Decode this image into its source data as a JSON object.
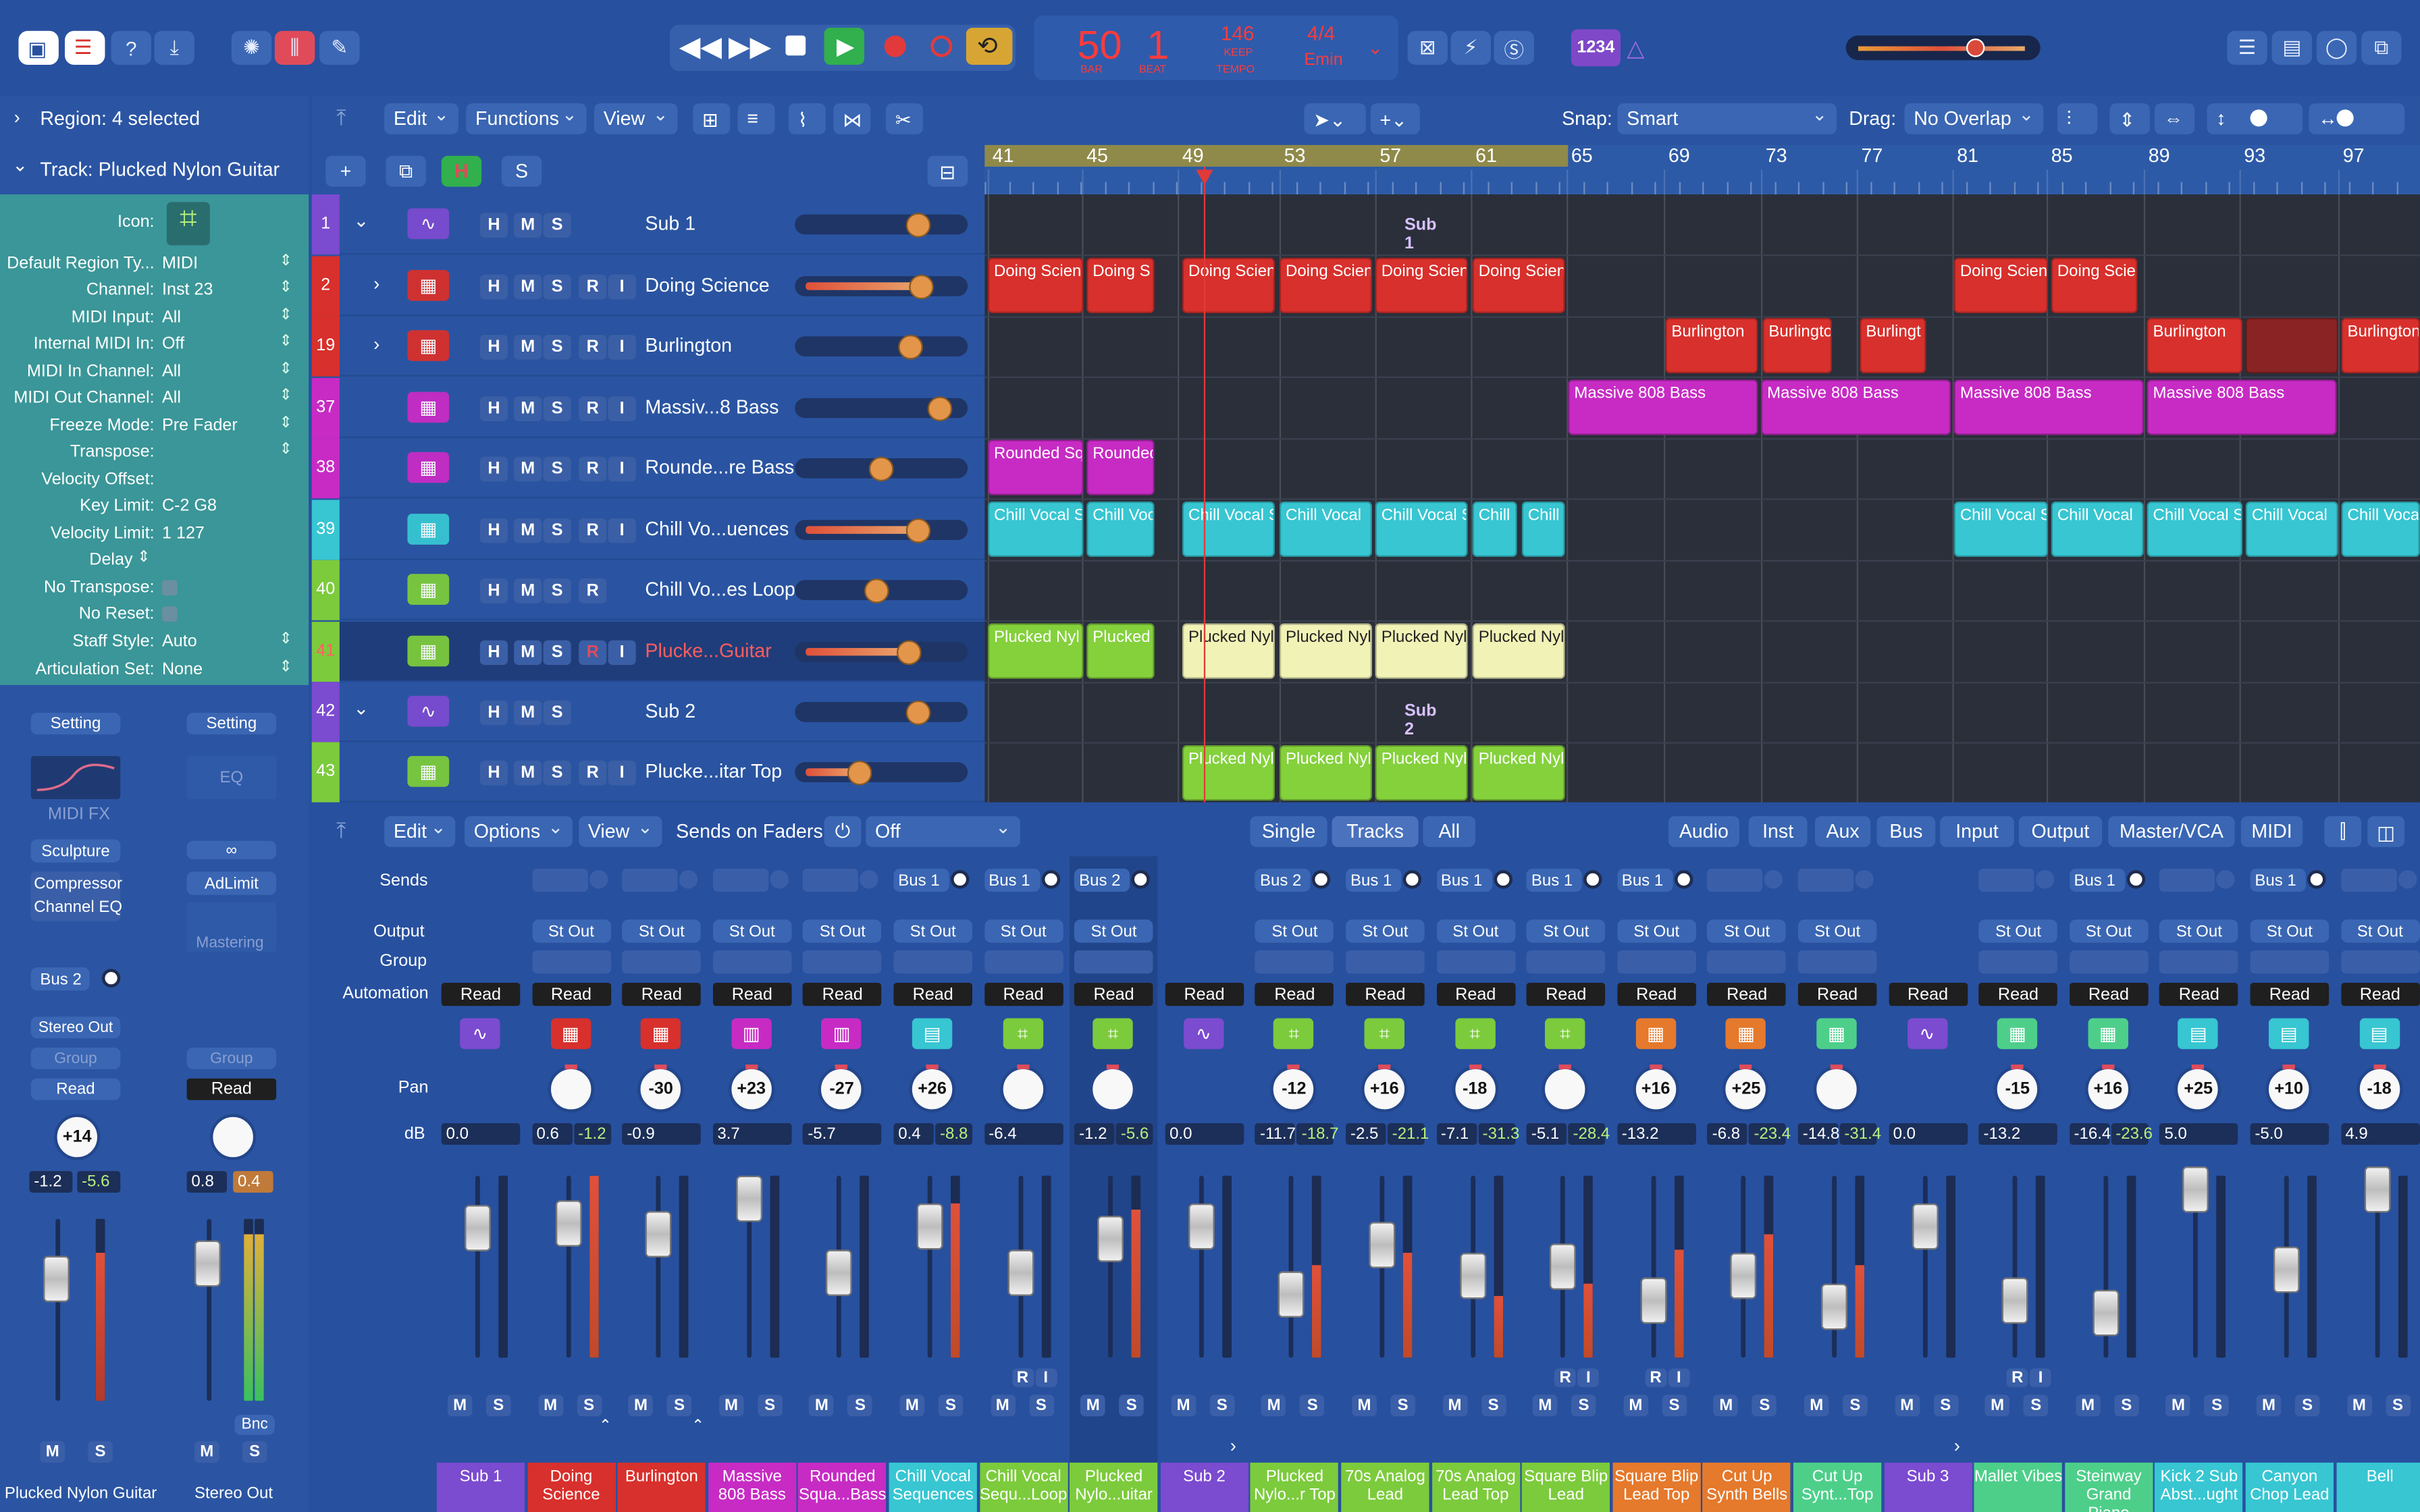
{
  "lcd": {
    "bar": "50",
    "bar_lbl": "BAR",
    "beat": "1",
    "beat_lbl": "BEAT",
    "tempo": "146",
    "keep": "KEEP",
    "tempo_lbl": "TEMPO",
    "sig": "4/4",
    "key": "Emin"
  },
  "count_in": "1234",
  "inspector": {
    "region": "Region: 4 selected",
    "track": "Track: Plucked Nylon Guitar",
    "rows": [
      [
        "Icon:",
        ""
      ],
      [
        "Default Region Ty...",
        "MIDI"
      ],
      [
        "Channel:",
        "Inst 23"
      ],
      [
        "MIDI Input:",
        "All"
      ],
      [
        "Internal MIDI In:",
        "Off"
      ],
      [
        "MIDI In Channel:",
        "All"
      ],
      [
        "MIDI Out Channel:",
        "All"
      ],
      [
        "Freeze Mode:",
        "Pre Fader"
      ],
      [
        "Transpose:",
        ""
      ],
      [
        "Velocity Offset:",
        ""
      ],
      [
        "Key Limit:",
        "C-2  G8"
      ],
      [
        "Velocity Limit:",
        "1  127"
      ],
      [
        "Delay",
        ""
      ],
      [
        "No Transpose:",
        ""
      ],
      [
        "No Reset:",
        ""
      ],
      [
        "Staff Style:",
        "Auto"
      ],
      [
        "Articulation Set:",
        "None"
      ]
    ],
    "strip1": {
      "setting": "Setting",
      "midifx": "MIDI FX",
      "plug1": "Sculpture",
      "plug2": "Compressor",
      "plug3": "Channel EQ",
      "send": "Bus 2",
      "out": "Stereo Out",
      "group": "Group",
      "read": "Read",
      "pan": "+14",
      "db1": "-1.2",
      "db2": "-5.6",
      "m": "M",
      "s": "S",
      "name": "Plucked Nylon Guitar"
    },
    "strip2": {
      "setting": "Setting",
      "eq": "EQ",
      "plug1": "AdLimit",
      "mastering": "Mastering",
      "group": "Group",
      "read": "Read",
      "db1": "0.8",
      "db2": "0.4",
      "bnc": "Bnc",
      "m": "M",
      "s": "S",
      "name": "Stereo Out"
    }
  },
  "tracks_toolbar": {
    "edit": "Edit",
    "functions": "Functions",
    "view": "View",
    "snap_lbl": "Snap:",
    "snap": "Smart",
    "drag_lbl": "Drag:",
    "drag": "No Overlap"
  },
  "ruler": [
    "41",
    "45",
    "49",
    "53",
    "57",
    "61",
    "65",
    "69",
    "73",
    "77",
    "81",
    "85",
    "89",
    "93",
    "97"
  ],
  "tracks": [
    {
      "num": "2",
      "name": "Doing Science",
      "color": "#d8302c",
      "btns": "HMSRI"
    },
    {
      "num": "19",
      "name": "Burlington",
      "color": "#d8302c",
      "btns": "HMSRI"
    },
    {
      "num": "37",
      "name": "Massiv...8 Bass",
      "color": "#c72bc4",
      "btns": "HMSRI"
    },
    {
      "num": "38",
      "name": "Rounde...re Bass",
      "color": "#c72bc4",
      "btns": "HMSRI"
    },
    {
      "num": "39",
      "name": "Chill Vo...uences",
      "color": "#37c6d2",
      "btns": "HMSRI"
    },
    {
      "num": "40",
      "name": "Chill Vo...es Loop",
      "color": "#7ccb3c",
      "btns": "HMSR"
    },
    {
      "num": "41",
      "name": "Plucke...Guitar",
      "color": "#7ccb3c",
      "btns": "HMSRI"
    },
    {
      "num": "43",
      "name": "Plucke...itar Top",
      "color": "#7ccb3c",
      "btns": "HMSRI"
    }
  ],
  "subs": [
    {
      "num": "1",
      "name": "Sub 1"
    },
    {
      "num": "42",
      "name": "Sub 2"
    }
  ],
  "regions": {
    "sub1": "Sub 1",
    "sub2": "Sub 2",
    "doing": [
      "Doing Scien",
      "Doing S",
      "Doing Scien",
      "Doing Scien",
      "Doing Scien",
      "Doing Scien",
      "Doing Scien",
      "Doing Scie"
    ],
    "burl": [
      "Burlington",
      "Burlingto",
      "Burlingt",
      "Burlington",
      "Burlington"
    ],
    "massive": [
      "Massive 808 Bass",
      "Massive 808 Bass",
      "Massive 808 Bass",
      "Massive 808 Bass"
    ],
    "rounded": [
      "Rounded Sq",
      "Rounded"
    ],
    "chill": [
      "Chill Vocal S",
      "Chill Voc",
      "Chill Vocal S",
      "Chill Vocal",
      "Chill Vocal S",
      "Chill",
      "Chill",
      "Chill Vocal S",
      "Chill Vocal",
      "Chill Vocal S",
      "Chill Vocal",
      "Chill Voca"
    ],
    "pluck": [
      "Plucked Nyl",
      "Plucked",
      "Plucked Nyl",
      "Plucked Nyl",
      "Plucked Nyl",
      "Plucked Nyl"
    ],
    "pluck2": [
      "Plucked Nyl",
      "Plucked Nyl",
      "Plucked Nyl",
      "Plucked Nyl"
    ]
  },
  "mixer_toolbar": {
    "edit": "Edit",
    "options": "Options",
    "view": "View",
    "sends_lbl": "Sends on Faders:",
    "sends": "Off",
    "single": "Single",
    "tracks": "Tracks",
    "all": "All",
    "filters": [
      "Audio",
      "Inst",
      "Aux",
      "Bus",
      "Input",
      "Output",
      "Master/VCA",
      "MIDI"
    ]
  },
  "mixer_labels": {
    "sends": "Sends",
    "output": "Output",
    "group": "Group",
    "automation": "Automation",
    "pan": "Pan",
    "db": "dB"
  },
  "channels": [
    {
      "name": "Sub 1",
      "color": "#7b4bd0",
      "send": "",
      "out": "",
      "pan": "",
      "db1": "0.0",
      "db2": ""
    },
    {
      "name": "Doing Science",
      "color": "#d8302c",
      "send": "",
      "out": "St Out",
      "pan": "",
      "db1": "0.6",
      "db2": "-1.2"
    },
    {
      "name": "Burlington",
      "color": "#d8302c",
      "send": "",
      "out": "St Out",
      "pan": "-30",
      "db1": "-0.9",
      "db2": ""
    },
    {
      "name": "Massive 808 Bass",
      "color": "#c72bc4",
      "send": "",
      "out": "St Out",
      "pan": "+23",
      "db1": "3.7",
      "db2": ""
    },
    {
      "name": "Rounded Squa...Bass",
      "color": "#c72bc4",
      "send": "",
      "out": "St Out",
      "pan": "-27",
      "db1": "-5.7",
      "db2": ""
    },
    {
      "name": "Chill Vocal Sequences",
      "color": "#37c6d2",
      "send": "Bus 1",
      "out": "St Out",
      "pan": "+26",
      "db1": "0.4",
      "db2": "-8.8"
    },
    {
      "name": "Chill Vocal Sequ...Loop",
      "color": "#7ccb3c",
      "send": "Bus 1",
      "out": "St Out",
      "pan": "",
      "db1": "-6.4",
      "db2": ""
    },
    {
      "name": "Plucked Nylo...uitar",
      "color": "#7ccb3c",
      "send": "Bus 2",
      "out": "St Out",
      "pan": "",
      "db1": "-1.2",
      "db2": "-5.6"
    },
    {
      "name": "Sub 2",
      "color": "#7b4bd0",
      "send": "",
      "out": "",
      "pan": "",
      "db1": "0.0",
      "db2": ""
    },
    {
      "name": "Plucked Nylo...r Top",
      "color": "#7ccb3c",
      "send": "Bus 2",
      "out": "St Out",
      "pan": "-12",
      "db1": "-11.7",
      "db2": "-18.7"
    },
    {
      "name": "70s Analog Lead",
      "color": "#7ccb3c",
      "send": "Bus 1",
      "out": "St Out",
      "pan": "+16",
      "db1": "-2.5",
      "db2": "-21.1"
    },
    {
      "name": "70s Analog Lead Top",
      "color": "#7ccb3c",
      "send": "Bus 1",
      "out": "St Out",
      "pan": "-18",
      "db1": "-7.1",
      "db2": "-31.3"
    },
    {
      "name": "Square Blip Lead",
      "color": "#7ccb3c",
      "send": "Bus 1",
      "out": "St Out",
      "pan": "",
      "db1": "-5.1",
      "db2": "-28.4"
    },
    {
      "name": "Square Blip Lead Top",
      "color": "#e5792c",
      "send": "Bus 1",
      "out": "St Out",
      "pan": "+16",
      "db1": "-13.2",
      "db2": ""
    },
    {
      "name": "Cut Up Synth Bells",
      "color": "#e5792c",
      "send": "",
      "out": "St Out",
      "pan": "+25",
      "db1": "-6.8",
      "db2": "-23.4"
    },
    {
      "name": "Cut Up Synt...Top",
      "color": "#4dcf8a",
      "send": "",
      "out": "St Out",
      "pan": "",
      "db1": "-14.8",
      "db2": "-31.4"
    },
    {
      "name": "Sub 3",
      "color": "#7b4bd0",
      "send": "",
      "out": "",
      "pan": "",
      "db1": "0.0",
      "db2": ""
    },
    {
      "name": "Mallet Vibes",
      "color": "#4dcf8a",
      "send": "",
      "out": "St Out",
      "pan": "-15",
      "db1": "-13.2",
      "db2": ""
    },
    {
      "name": "Steinway Grand Piano",
      "color": "#4dcf8a",
      "send": "Bus 1",
      "out": "St Out",
      "pan": "+16",
      "db1": "-16.4",
      "db2": "-23.6"
    },
    {
      "name": "Kick 2 Sub Abst...ught",
      "color": "#37c6d2",
      "send": "",
      "out": "St Out",
      "pan": "+25",
      "db1": "5.0",
      "db2": ""
    },
    {
      "name": "Canyon Chop Lead",
      "color": "#37c6d2",
      "send": "Bus 1",
      "out": "St Out",
      "pan": "+10",
      "db1": "-5.0",
      "db2": ""
    },
    {
      "name": "Bell",
      "color": "#37c6d2",
      "send": "",
      "out": "St Out",
      "pan": "-18",
      "db1": "4.9",
      "db2": ""
    }
  ],
  "read": "Read",
  "m": "M",
  "s": "S",
  "r": "R",
  "i": "I"
}
